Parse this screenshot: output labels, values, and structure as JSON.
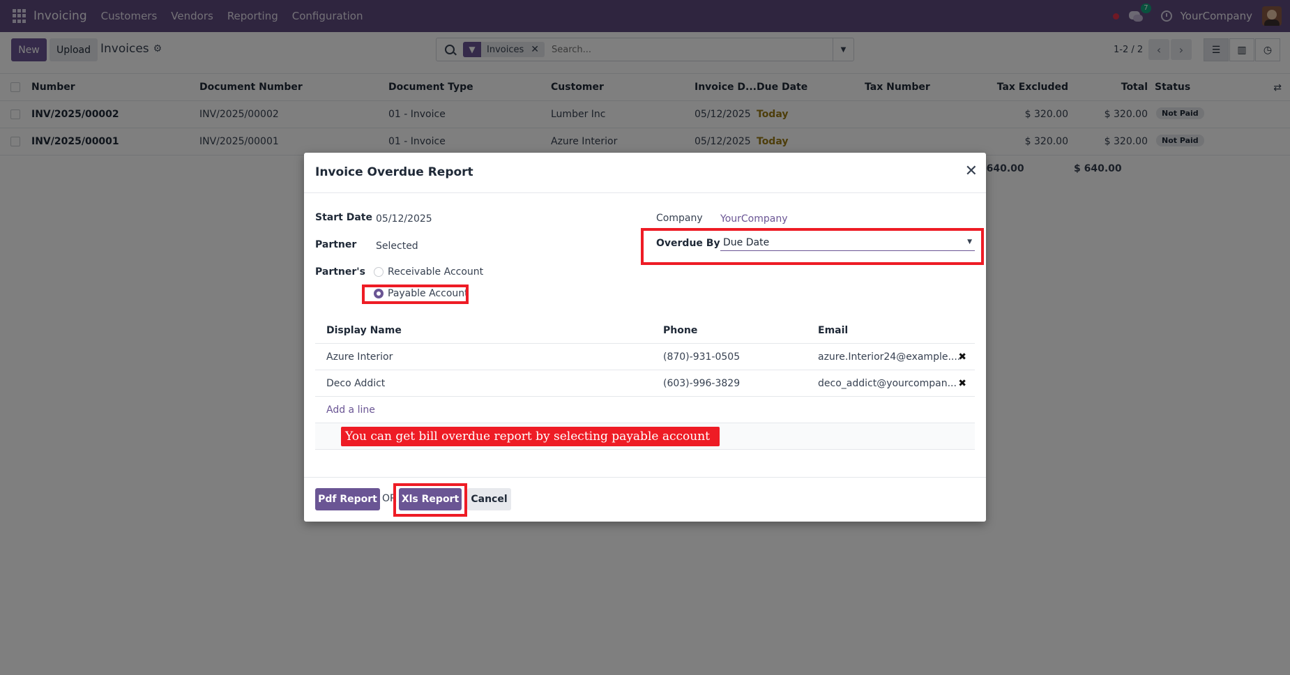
{
  "navbar": {
    "app_name": "Invoicing",
    "menu": [
      "Customers",
      "Vendors",
      "Reporting",
      "Configuration"
    ],
    "chat_count": "7",
    "company": "YourCompany",
    "brand_color": "#5f4b7e"
  },
  "control": {
    "new_label": "New",
    "upload_label": "Upload",
    "breadcrumb": "Invoices",
    "facet_label": "Invoices",
    "search_placeholder": "Search...",
    "pager": "1-2 / 2"
  },
  "list": {
    "columns": [
      "Number",
      "Document Number",
      "Document Type",
      "Customer",
      "Invoice D...",
      "Due Date",
      "Tax Number",
      "Tax Excluded",
      "Total",
      "Status"
    ],
    "rows": [
      {
        "number": "INV/2025/00002",
        "doc_number": "INV/2025/00002",
        "doc_type": "01 - Invoice",
        "customer": "Lumber Inc",
        "invoice_date": "05/12/2025",
        "due_date": "Today",
        "tax_number": "",
        "tax_excluded": "$ 320.00",
        "total": "$ 320.00",
        "status": "Not Paid"
      },
      {
        "number": "INV/2025/00001",
        "doc_number": "INV/2025/00001",
        "doc_type": "01 - Invoice",
        "customer": "Azure Interior",
        "invoice_date": "05/12/2025",
        "due_date": "Today",
        "tax_number": "",
        "tax_excluded": "$ 320.00",
        "total": "$ 320.00",
        "status": "Not Paid"
      }
    ],
    "totals": {
      "tax_excluded": "$ 640.00",
      "total": "$ 640.00"
    }
  },
  "modal": {
    "title": "Invoice Overdue Report",
    "start_date_label": "Start Date",
    "start_date": "05/12/2025",
    "partner_label": "Partner",
    "partner_value": "Selected",
    "partners_label": "Partner's",
    "radio_receivable": "Receivable Account",
    "radio_payable": "Payable Account",
    "selected_account": "Payable Account",
    "company_label": "Company",
    "company_value": "YourCompany",
    "overdue_by_label": "Overdue By",
    "overdue_by_value": "Due Date",
    "table_columns": [
      "Display Name",
      "Phone",
      "Email"
    ],
    "table_rows": [
      {
        "name": "Azure Interior",
        "phone": "(870)-931-0505",
        "email": "azure.Interior24@example...."
      },
      {
        "name": "Deco Addict",
        "phone": "(603)-996-3829",
        "email": "deco_addict@yourcompan..."
      }
    ],
    "add_line": "Add a line",
    "annotation": "You can get bill overdue report by selecting payable account",
    "pdf_button": "Pdf Report",
    "or_text": "OR",
    "xls_button": "Xls Report",
    "cancel_button": "Cancel",
    "highlight_color": "#ee1c25"
  }
}
